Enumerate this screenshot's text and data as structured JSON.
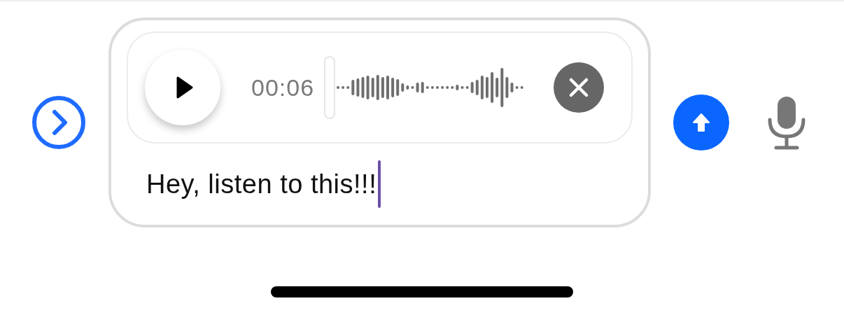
{
  "audio_clip": {
    "duration": "00:06"
  },
  "message": {
    "value": "Hey, listen to this!!!"
  }
}
